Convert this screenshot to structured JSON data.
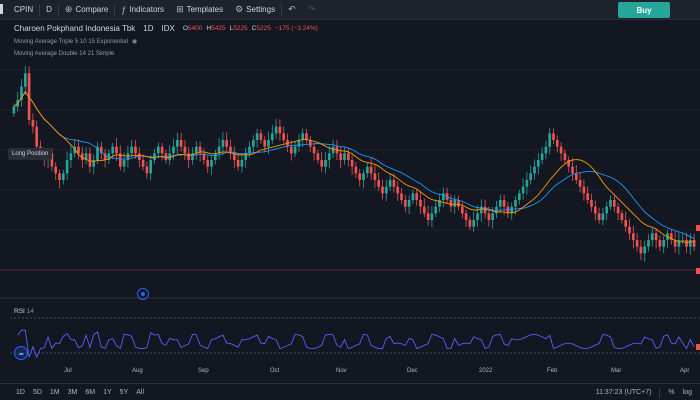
{
  "topbar": {
    "symbol": "CPIN",
    "interval": "D",
    "compare": "Compare",
    "indicators": "Indicators",
    "templates": "Templates",
    "settings": "Settings",
    "undo_icon": "undo-icon",
    "redo_icon": "redo-icon",
    "buy": "Buy"
  },
  "legend": {
    "name": "Charoen Pokphand Indonesia Tbk",
    "interval": "1D",
    "exchange": "IDX",
    "o_key": "O",
    "o_val": "5400",
    "h_key": "H",
    "h_val": "5425",
    "l_key": "L",
    "l_val": "5225",
    "c_key": "C",
    "c_val": "5225",
    "change": "−175 (−3.24%)",
    "ma_triple": "Moving Average Triple 5 10 15 Exponential",
    "ma_double": "Moving Average Double 14 21 Simple"
  },
  "long_position": "Long Position",
  "rsi": {
    "label": "RSI",
    "period": "14"
  },
  "time_axis": [
    "Jul",
    "Aug",
    "Sep",
    "Oct",
    "Nov",
    "Dec",
    "2022",
    "Feb",
    "Mar",
    "Apr"
  ],
  "bottombar": {
    "ranges": [
      "1D",
      "5D",
      "1M",
      "3M",
      "6M",
      "1Y",
      "5Y",
      "All"
    ],
    "clock": "11:37:23 (UTC+7)",
    "percent": "%",
    "log": "log"
  },
  "colors": {
    "up": "#26a69a",
    "down": "#ef5350",
    "ma1": "#2196f3",
    "ma2": "#ff9800",
    "rsi": "#5b5ef5"
  },
  "chart_data": {
    "type": "candlestick",
    "closes": [
      5650,
      5700,
      5800,
      5900,
      5550,
      5500,
      5350,
      5300,
      5250,
      5300,
      5200,
      5150,
      5100,
      5150,
      5250,
      5300,
      5350,
      5300,
      5250,
      5300,
      5200,
      5250,
      5350,
      5300,
      5250,
      5300,
      5350,
      5300,
      5200,
      5250,
      5300,
      5350,
      5300,
      5250,
      5200,
      5150,
      5250,
      5300,
      5350,
      5300,
      5250,
      5300,
      5350,
      5400,
      5350,
      5300,
      5250,
      5300,
      5350,
      5300,
      5250,
      5200,
      5250,
      5300,
      5350,
      5400,
      5350,
      5300,
      5250,
      5200,
      5250,
      5300,
      5350,
      5400,
      5450,
      5400,
      5350,
      5400,
      5450,
      5500,
      5450,
      5400,
      5350,
      5300,
      5350,
      5400,
      5450,
      5400,
      5350,
      5300,
      5250,
      5200,
      5250,
      5300,
      5350,
      5300,
      5250,
      5300,
      5250,
      5200,
      5150,
      5100,
      5150,
      5200,
      5150,
      5100,
      5050,
      5000,
      5050,
      5100,
      5050,
      5000,
      4950,
      4900,
      4950,
      5000,
      4950,
      4900,
      4850,
      4800,
      4850,
      4900,
      4950,
      5000,
      4950,
      4900,
      4950,
      4900,
      4850,
      4800,
      4750,
      4800,
      4850,
      4900,
      4850,
      4800,
      4850,
      4900,
      4950,
      4900,
      4850,
      4900,
      4950,
      5000,
      5050,
      5100,
      5150,
      5200,
      5250,
      5300,
      5350,
      5450,
      5400,
      5350,
      5300,
      5250,
      5200,
      5150,
      5100,
      5050,
      5000,
      4950,
      4900,
      4850,
      4800,
      4850,
      4900,
      4950,
      4900,
      4850,
      4800,
      4750,
      4700,
      4650,
      4600,
      4550,
      4600,
      4650,
      4700,
      4650,
      4600,
      4650,
      4700,
      4650,
      4600,
      4650,
      4650,
      4600,
      4650,
      4600
    ]
  }
}
